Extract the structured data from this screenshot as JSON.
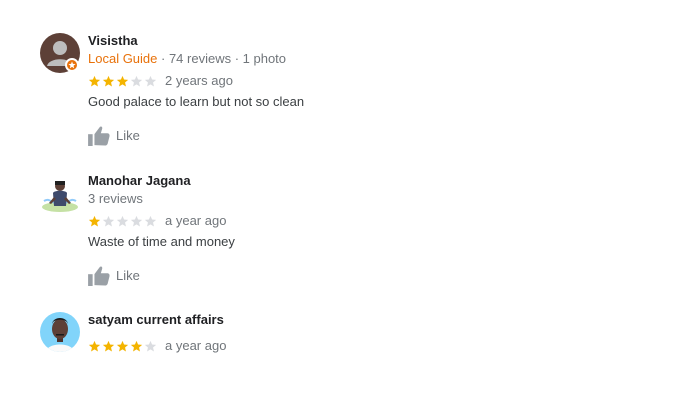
{
  "colors": {
    "star_filled": "#f4b400",
    "star_empty": "#dadce0",
    "local_guide": "#e8710a",
    "muted": "#70757a"
  },
  "reviews": [
    {
      "author": "Visistha",
      "local_guide_label": "Local Guide",
      "stats": "· 74 reviews · 1 photo",
      "rating": 3,
      "date": "2 years ago",
      "text": "Good palace to learn but not so clean",
      "like_label": "Like",
      "avatar_icon": "default-person-icon"
    },
    {
      "author": "Manohar Jagana",
      "stats": "3 reviews",
      "rating": 1,
      "date": "a year ago",
      "text": "Waste of time and money",
      "like_label": "Like",
      "avatar_icon": "person-photo"
    },
    {
      "author": "satyam current affairs",
      "rating": 4,
      "date": "a year ago",
      "avatar_icon": "person-photo"
    }
  ]
}
